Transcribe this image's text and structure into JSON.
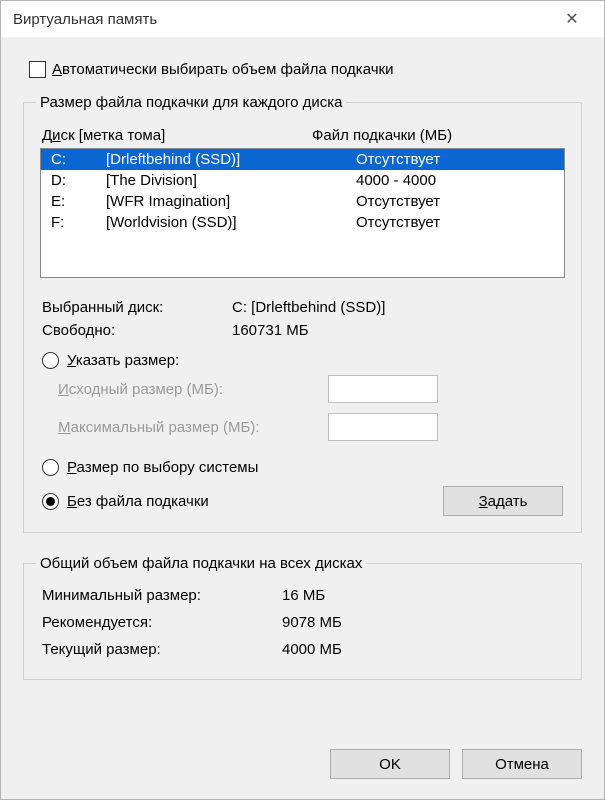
{
  "window": {
    "title": "Виртуальная память"
  },
  "autoManage": {
    "label_pre_u": "",
    "label_u": "А",
    "label_rest": "втоматически выбирать объем файла подкачки",
    "checked": false
  },
  "group1": {
    "legend": "Размер файла подкачки для каждого диска",
    "header_pre_u": "Д",
    "header_u": "и",
    "header_rest": "ск [метка тома]",
    "header_page": "Файл подкачки (МБ)",
    "rows": [
      {
        "letter": "C:",
        "label": "[Drleftbehind (SSD)]",
        "page": "Отсутствует",
        "selected": true
      },
      {
        "letter": "D:",
        "label": "[The Division]",
        "page": "4000 - 4000",
        "selected": false
      },
      {
        "letter": "E:",
        "label": "[WFR Imagination]",
        "page": "Отсутствует",
        "selected": false
      },
      {
        "letter": "F:",
        "label": "[Worldvision (SSD)]",
        "page": "Отсутствует",
        "selected": false
      }
    ],
    "selected_drive_label": "Выбранный диск:",
    "selected_drive_value": "C:  [Drleftbehind (SSD)]",
    "free_label": "Свободно:",
    "free_value": "160731 МБ",
    "radio_custom_pre": "",
    "radio_custom_u": "У",
    "radio_custom_rest": "казать размер:",
    "initial_pre": "",
    "initial_u": "И",
    "initial_rest": "сходный размер (МБ):",
    "max_pre": "",
    "max_u": "М",
    "max_rest": "аксимальный размер (МБ):",
    "radio_system_pre": "",
    "radio_system_u": "Р",
    "radio_system_rest": "азмер по выбору системы",
    "radio_none_pre": "",
    "radio_none_u": "Б",
    "radio_none_rest": "ез файла подкачки",
    "set_btn_pre": "",
    "set_btn_u": "З",
    "set_btn_rest": "адать",
    "selected_radio": "none"
  },
  "group2": {
    "legend": "Общий объем файла подкачки на всех дисках",
    "min_label": "Минимальный размер:",
    "min_value": "16 МБ",
    "rec_label": "Рекомендуется:",
    "rec_value": "9078 МБ",
    "cur_label": "Текущий размер:",
    "cur_value": "4000 МБ"
  },
  "footer": {
    "ok": "OK",
    "cancel": "Отмена"
  }
}
